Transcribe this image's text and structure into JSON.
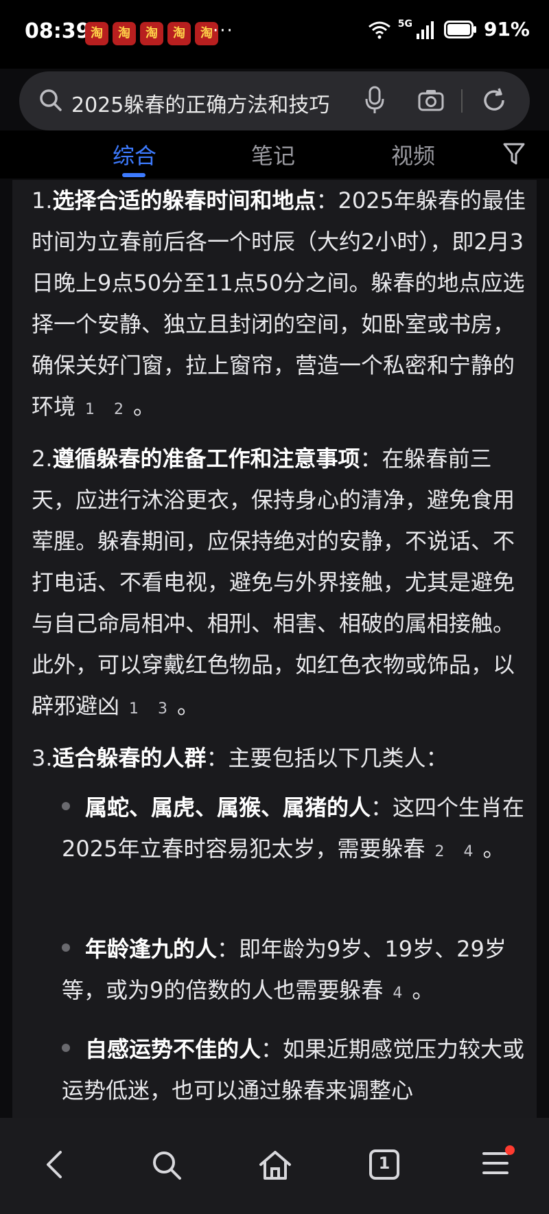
{
  "status_bar": {
    "time": "08:39",
    "app_icon_glyph": "淘",
    "more": "···",
    "network": "5G",
    "battery": "91%"
  },
  "search": {
    "query": "2025躲春的正确方法和技巧"
  },
  "tabs": [
    {
      "label": "综合",
      "active": true
    },
    {
      "label": "笔记",
      "active": false
    },
    {
      "label": "视频",
      "active": false
    }
  ],
  "content": {
    "item1": {
      "num": "1.",
      "title": "选择合适的躲春时间和地点",
      "text": "：2025年躲春的最佳时间为立春前后各一个时辰（大约2小时），即2月3日晚上9点50分至11点50分之间。躲春的地点应选择一个安静、独立且封闭的空间，如卧室或书房，确保关好门窗，拉上窗帘，营造一个私密和宁静的环境",
      "refs": [
        "1",
        "2"
      ],
      "end": "。"
    },
    "item2": {
      "num": "2.",
      "title": "遵循躲春的准备工作和注意事项",
      "text": "：在躲春前三天，应进行沐浴更衣，保持身心的清净，避免食用荤腥。躲春期间，应保持绝对的安静，不说话、不打电话、不看电视，避免与外界接触，尤其是避免与自己命局相冲、相刑、相害、相破的属相接触。此外，可以穿戴红色物品，如红色衣物或饰品，以辟邪避凶",
      "refs": [
        "1",
        "3"
      ],
      "end": "。"
    },
    "item3": {
      "num": "3.",
      "title": "适合躲春的人群",
      "text": "：主要包括以下几类人："
    },
    "bullets": [
      {
        "title": "属蛇、属虎、属猴、属猪的人",
        "text": "：这四个生肖在2025年立春时容易犯太岁，需要躲春",
        "refs": [
          "2",
          "4"
        ],
        "end": "。"
      },
      {
        "title": "年龄逢九的人",
        "text": "：即年龄为9岁、19岁、29岁等，或为9的倍数的人也需要躲春",
        "refs": [
          "4"
        ],
        "end": "。"
      },
      {
        "title": "自感运势不佳的人",
        "text": "：如果近期感觉压力较大或运势低迷，也可以通过躲春来调整心"
      }
    ]
  },
  "bottom_nav": {
    "tab_count": "1"
  },
  "colors": {
    "accent": "#3d7bff",
    "badge": "#ff3b30"
  }
}
